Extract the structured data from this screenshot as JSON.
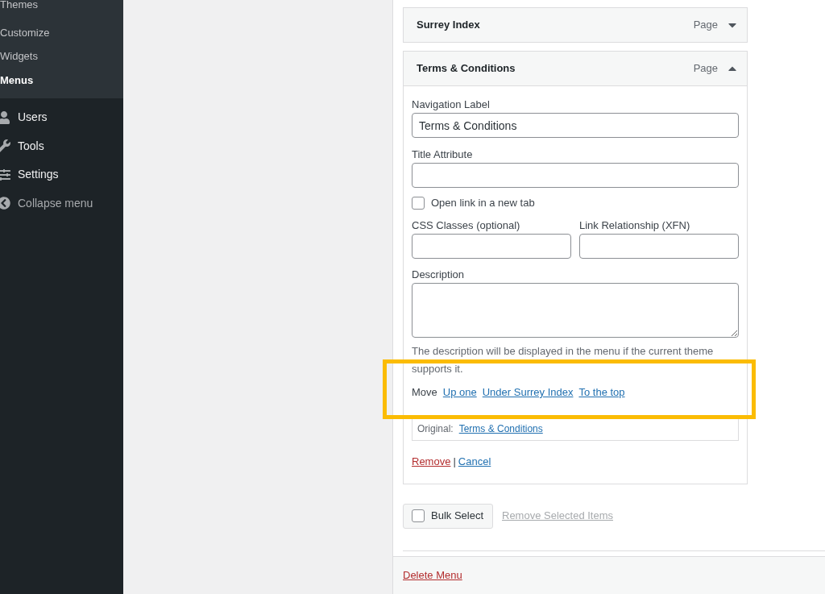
{
  "sidebar": {
    "submenu": [
      {
        "label": "Themes",
        "selected": false
      },
      {
        "label": "Customize",
        "selected": false
      },
      {
        "label": "Widgets",
        "selected": false
      },
      {
        "label": "Menus",
        "selected": true
      }
    ],
    "items": [
      {
        "label": "Users",
        "kind": "users"
      },
      {
        "label": "Tools",
        "kind": "tools"
      },
      {
        "label": "Settings",
        "kind": "settings"
      },
      {
        "label": "Collapse menu",
        "kind": "collapse"
      }
    ]
  },
  "menu_items": [
    {
      "title": "Surrey Index",
      "type": "Page",
      "expanded": false
    },
    {
      "title": "Terms & Conditions",
      "type": "Page",
      "expanded": true
    }
  ],
  "item_settings": {
    "navigation_label": {
      "label": "Navigation Label",
      "value": "Terms & Conditions"
    },
    "title_attribute": {
      "label": "Title Attribute"
    },
    "new_tab": {
      "label": "Open link in a new tab",
      "checked": false
    },
    "css_classes": {
      "label": "CSS Classes (optional)"
    },
    "xfn": {
      "label": "Link Relationship (XFN)"
    },
    "description": {
      "label": "Description",
      "help": "The description will be displayed in the menu if the current theme supports it."
    },
    "move": {
      "label": "Move",
      "links": [
        "Up one",
        "Under Surrey Index",
        "To the top"
      ]
    },
    "original": {
      "label": "Original:",
      "link": "Terms & Conditions"
    },
    "remove": "Remove",
    "separator": "|",
    "cancel": "Cancel"
  },
  "bulk_select": {
    "label": "Bulk Select",
    "checked": false
  },
  "remove_selected": "Remove Selected Items",
  "delete_menu": "Delete Menu"
}
